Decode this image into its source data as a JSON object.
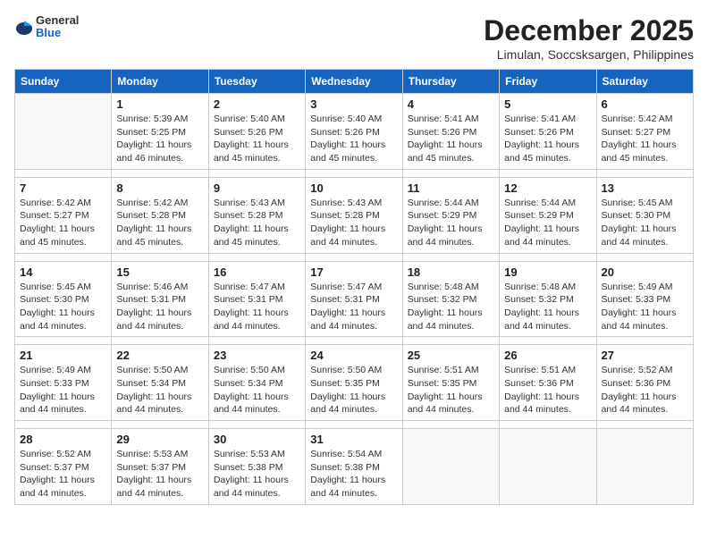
{
  "header": {
    "logo_general": "General",
    "logo_blue": "Blue",
    "month_title": "December 2025",
    "location": "Limulan, Soccsksargen, Philippines"
  },
  "days_of_week": [
    "Sunday",
    "Monday",
    "Tuesday",
    "Wednesday",
    "Thursday",
    "Friday",
    "Saturday"
  ],
  "weeks": [
    [
      {
        "day": "",
        "sunrise": "",
        "sunset": "",
        "daylight": ""
      },
      {
        "day": "1",
        "sunrise": "Sunrise: 5:39 AM",
        "sunset": "Sunset: 5:25 PM",
        "daylight": "Daylight: 11 hours and 46 minutes."
      },
      {
        "day": "2",
        "sunrise": "Sunrise: 5:40 AM",
        "sunset": "Sunset: 5:26 PM",
        "daylight": "Daylight: 11 hours and 45 minutes."
      },
      {
        "day": "3",
        "sunrise": "Sunrise: 5:40 AM",
        "sunset": "Sunset: 5:26 PM",
        "daylight": "Daylight: 11 hours and 45 minutes."
      },
      {
        "day": "4",
        "sunrise": "Sunrise: 5:41 AM",
        "sunset": "Sunset: 5:26 PM",
        "daylight": "Daylight: 11 hours and 45 minutes."
      },
      {
        "day": "5",
        "sunrise": "Sunrise: 5:41 AM",
        "sunset": "Sunset: 5:26 PM",
        "daylight": "Daylight: 11 hours and 45 minutes."
      },
      {
        "day": "6",
        "sunrise": "Sunrise: 5:42 AM",
        "sunset": "Sunset: 5:27 PM",
        "daylight": "Daylight: 11 hours and 45 minutes."
      }
    ],
    [
      {
        "day": "7",
        "sunrise": "Sunrise: 5:42 AM",
        "sunset": "Sunset: 5:27 PM",
        "daylight": "Daylight: 11 hours and 45 minutes."
      },
      {
        "day": "8",
        "sunrise": "Sunrise: 5:42 AM",
        "sunset": "Sunset: 5:28 PM",
        "daylight": "Daylight: 11 hours and 45 minutes."
      },
      {
        "day": "9",
        "sunrise": "Sunrise: 5:43 AM",
        "sunset": "Sunset: 5:28 PM",
        "daylight": "Daylight: 11 hours and 45 minutes."
      },
      {
        "day": "10",
        "sunrise": "Sunrise: 5:43 AM",
        "sunset": "Sunset: 5:28 PM",
        "daylight": "Daylight: 11 hours and 44 minutes."
      },
      {
        "day": "11",
        "sunrise": "Sunrise: 5:44 AM",
        "sunset": "Sunset: 5:29 PM",
        "daylight": "Daylight: 11 hours and 44 minutes."
      },
      {
        "day": "12",
        "sunrise": "Sunrise: 5:44 AM",
        "sunset": "Sunset: 5:29 PM",
        "daylight": "Daylight: 11 hours and 44 minutes."
      },
      {
        "day": "13",
        "sunrise": "Sunrise: 5:45 AM",
        "sunset": "Sunset: 5:30 PM",
        "daylight": "Daylight: 11 hours and 44 minutes."
      }
    ],
    [
      {
        "day": "14",
        "sunrise": "Sunrise: 5:45 AM",
        "sunset": "Sunset: 5:30 PM",
        "daylight": "Daylight: 11 hours and 44 minutes."
      },
      {
        "day": "15",
        "sunrise": "Sunrise: 5:46 AM",
        "sunset": "Sunset: 5:31 PM",
        "daylight": "Daylight: 11 hours and 44 minutes."
      },
      {
        "day": "16",
        "sunrise": "Sunrise: 5:47 AM",
        "sunset": "Sunset: 5:31 PM",
        "daylight": "Daylight: 11 hours and 44 minutes."
      },
      {
        "day": "17",
        "sunrise": "Sunrise: 5:47 AM",
        "sunset": "Sunset: 5:31 PM",
        "daylight": "Daylight: 11 hours and 44 minutes."
      },
      {
        "day": "18",
        "sunrise": "Sunrise: 5:48 AM",
        "sunset": "Sunset: 5:32 PM",
        "daylight": "Daylight: 11 hours and 44 minutes."
      },
      {
        "day": "19",
        "sunrise": "Sunrise: 5:48 AM",
        "sunset": "Sunset: 5:32 PM",
        "daylight": "Daylight: 11 hours and 44 minutes."
      },
      {
        "day": "20",
        "sunrise": "Sunrise: 5:49 AM",
        "sunset": "Sunset: 5:33 PM",
        "daylight": "Daylight: 11 hours and 44 minutes."
      }
    ],
    [
      {
        "day": "21",
        "sunrise": "Sunrise: 5:49 AM",
        "sunset": "Sunset: 5:33 PM",
        "daylight": "Daylight: 11 hours and 44 minutes."
      },
      {
        "day": "22",
        "sunrise": "Sunrise: 5:50 AM",
        "sunset": "Sunset: 5:34 PM",
        "daylight": "Daylight: 11 hours and 44 minutes."
      },
      {
        "day": "23",
        "sunrise": "Sunrise: 5:50 AM",
        "sunset": "Sunset: 5:34 PM",
        "daylight": "Daylight: 11 hours and 44 minutes."
      },
      {
        "day": "24",
        "sunrise": "Sunrise: 5:50 AM",
        "sunset": "Sunset: 5:35 PM",
        "daylight": "Daylight: 11 hours and 44 minutes."
      },
      {
        "day": "25",
        "sunrise": "Sunrise: 5:51 AM",
        "sunset": "Sunset: 5:35 PM",
        "daylight": "Daylight: 11 hours and 44 minutes."
      },
      {
        "day": "26",
        "sunrise": "Sunrise: 5:51 AM",
        "sunset": "Sunset: 5:36 PM",
        "daylight": "Daylight: 11 hours and 44 minutes."
      },
      {
        "day": "27",
        "sunrise": "Sunrise: 5:52 AM",
        "sunset": "Sunset: 5:36 PM",
        "daylight": "Daylight: 11 hours and 44 minutes."
      }
    ],
    [
      {
        "day": "28",
        "sunrise": "Sunrise: 5:52 AM",
        "sunset": "Sunset: 5:37 PM",
        "daylight": "Daylight: 11 hours and 44 minutes."
      },
      {
        "day": "29",
        "sunrise": "Sunrise: 5:53 AM",
        "sunset": "Sunset: 5:37 PM",
        "daylight": "Daylight: 11 hours and 44 minutes."
      },
      {
        "day": "30",
        "sunrise": "Sunrise: 5:53 AM",
        "sunset": "Sunset: 5:38 PM",
        "daylight": "Daylight: 11 hours and 44 minutes."
      },
      {
        "day": "31",
        "sunrise": "Sunrise: 5:54 AM",
        "sunset": "Sunset: 5:38 PM",
        "daylight": "Daylight: 11 hours and 44 minutes."
      },
      {
        "day": "",
        "sunrise": "",
        "sunset": "",
        "daylight": ""
      },
      {
        "day": "",
        "sunrise": "",
        "sunset": "",
        "daylight": ""
      },
      {
        "day": "",
        "sunrise": "",
        "sunset": "",
        "daylight": ""
      }
    ]
  ]
}
